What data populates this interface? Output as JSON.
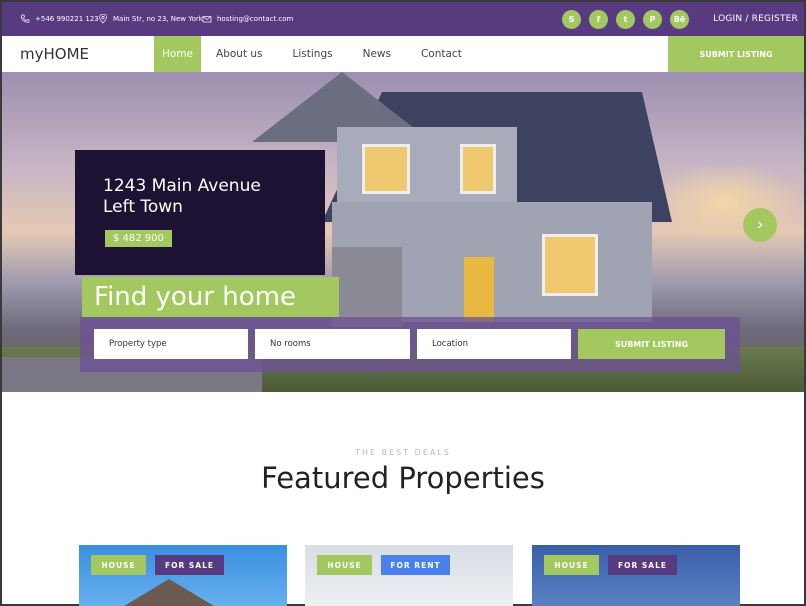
{
  "topbar": {
    "phone": "+546 990221 123",
    "address": "Main Str, no 23, New York",
    "email": "hosting@contact.com",
    "socials": [
      {
        "name": "skype-icon",
        "glyph": "S"
      },
      {
        "name": "facebook-icon",
        "glyph": "f"
      },
      {
        "name": "twitter-icon",
        "glyph": "t"
      },
      {
        "name": "pinterest-icon",
        "glyph": "P"
      },
      {
        "name": "behance-icon",
        "glyph": "Bē"
      }
    ],
    "login_label": "LOGIN / REGISTER"
  },
  "nav": {
    "logo_prefix": "my",
    "logo_suffix": "HOME",
    "items": [
      {
        "label": "Home",
        "active": true
      },
      {
        "label": "About us",
        "active": false
      },
      {
        "label": "Listings",
        "active": false
      },
      {
        "label": "News",
        "active": false
      },
      {
        "label": "Contact",
        "active": false
      }
    ],
    "submit_label": "SUBMIT LISTING"
  },
  "hero": {
    "address_line1": "1243 Main Avenue",
    "address_line2": "Left Town",
    "price": "$ 482 900",
    "headline": "Find your home",
    "search": {
      "property_type_placeholder": "Property type",
      "rooms_placeholder": "No rooms",
      "location_placeholder": "Location",
      "submit_label": "SUBMIT LISTING"
    },
    "next_glyph": "›"
  },
  "featured": {
    "eyebrow": "THE BEST DEALS",
    "title": "Featured Properties",
    "cards": [
      {
        "type": "HOUSE",
        "status": "FOR SALE"
      },
      {
        "type": "HOUSE",
        "status": "FOR RENT"
      },
      {
        "type": "HOUSE",
        "status": "FOR SALE"
      }
    ]
  },
  "colors": {
    "brand_purple": "#573a80",
    "accent_green": "#a3c860",
    "card_dark": "#1d1233",
    "rent_blue": "#4a80ec"
  }
}
